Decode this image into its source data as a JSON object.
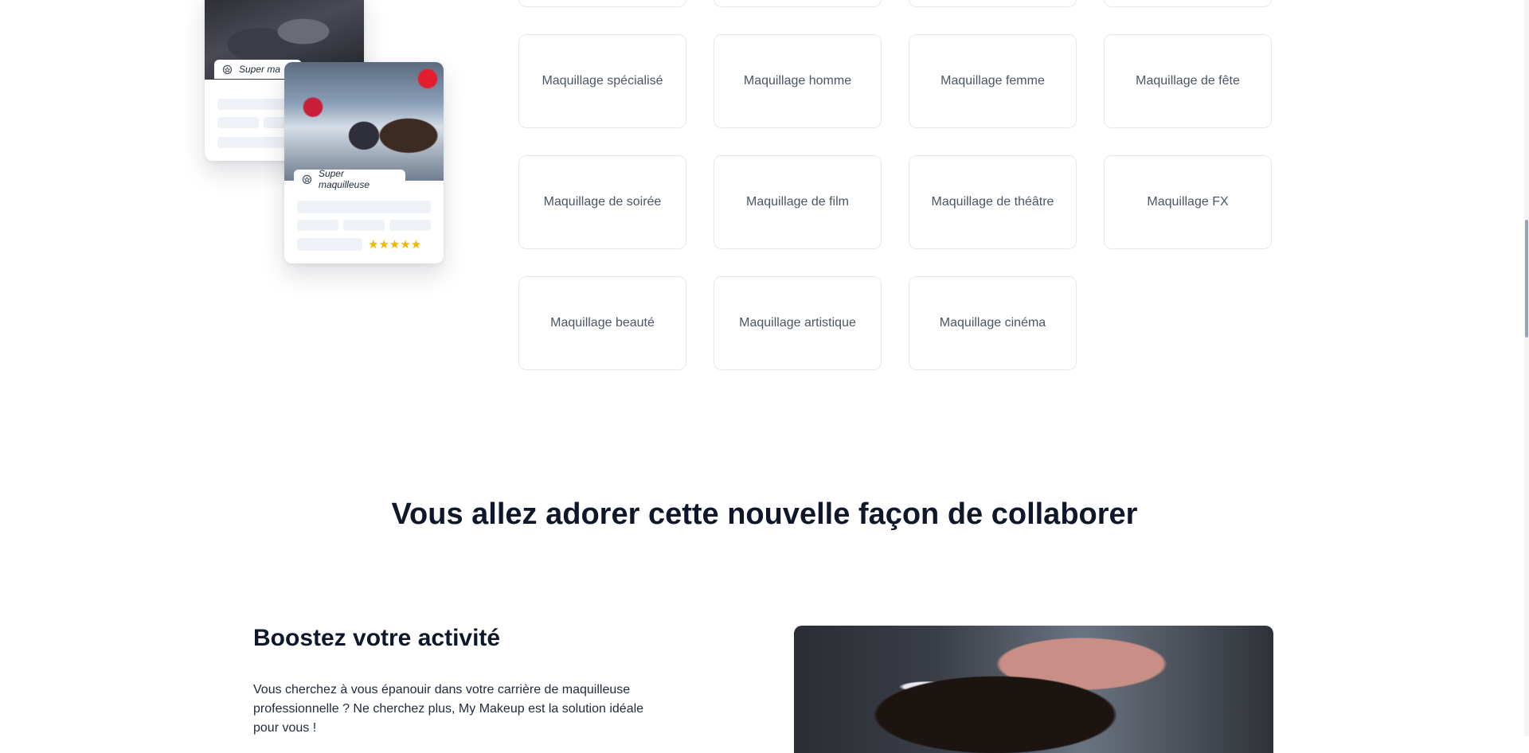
{
  "categories_partial_count": 4,
  "categories": [
    "Maquillage spécialisé",
    "Maquillage homme",
    "Maquillage femme",
    "Maquillage de fête",
    "Maquillage de soirée",
    "Maquillage de film",
    "Maquillage de théâtre",
    "Maquillage FX",
    "Maquillage beauté",
    "Maquillage artistique",
    "Maquillage cinéma"
  ],
  "illustration": {
    "back_card_badge": "Super ma",
    "front_card_badge": "Super maquilleuse",
    "rating_stars": "★★★★★",
    "rating_value": 5
  },
  "section": {
    "title": "Vous allez adorer cette nouvelle façon de collaborer"
  },
  "feature": {
    "title": "Boostez votre activité",
    "paragraph": "Vous cherchez à vous épanouir dans votre carrière de maquilleuse professionnelle ? Ne cherchez plus, My Makeup est la solution idéale pour vous !"
  },
  "colors": {
    "star": "#f4b400",
    "heading": "#0f172a",
    "card_border": "#e5e7eb",
    "skeleton": "#eef1f6"
  },
  "icons": [
    "badge-icon",
    "star-icon"
  ]
}
